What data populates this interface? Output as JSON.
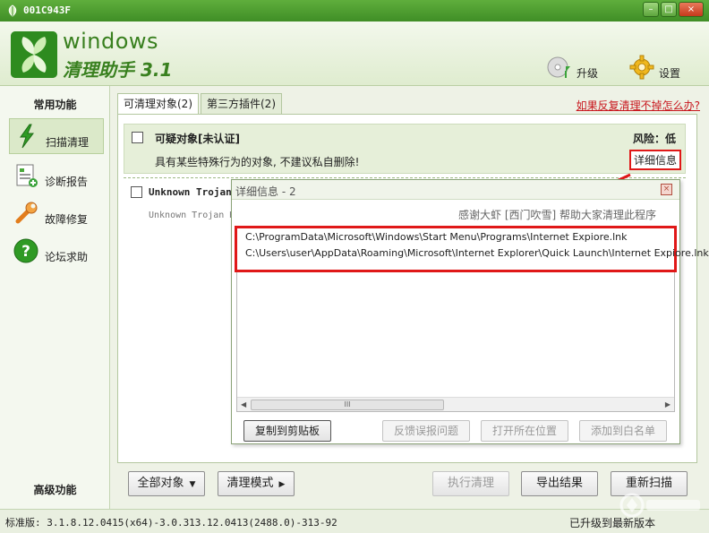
{
  "window": {
    "title": "001C943F",
    "min_glyph": "–",
    "max_glyph": "□",
    "close_glyph": "×"
  },
  "brand": {
    "line1": "windows",
    "line2": "清理助手 3.1"
  },
  "header": {
    "upgrade_label": "升级",
    "settings_label": "设置"
  },
  "sidebar": {
    "common_heading": "常用功能",
    "items": [
      {
        "label": "扫描清理",
        "icon": "lightning-icon",
        "active": true
      },
      {
        "label": "诊断报告",
        "icon": "report-icon"
      },
      {
        "label": "故障修复",
        "icon": "wrench-icon"
      },
      {
        "label": "论坛求助",
        "icon": "help-icon"
      }
    ],
    "advanced_heading": "高级功能"
  },
  "tabs": [
    {
      "label": "可清理对象(2)"
    },
    {
      "label": "第三方插件(2)"
    }
  ],
  "help_link": "如果反复清理不掉怎么办?",
  "items": [
    {
      "title": "可疑对象[未认证]",
      "risk": "风险：低",
      "desc": "具有某些特殊行为的对象, 不建议私自删除!",
      "detail": "详细信息"
    },
    {
      "title": "Unknown Trojan",
      "desc": "Unknown Trojan H"
    }
  ],
  "popup": {
    "title": "详细信息 - 2",
    "thanks": "感谢大虾 [西门吹雪] 帮助大家清理此程序",
    "paths": [
      "C:\\ProgramData\\Microsoft\\Windows\\Start Menu\\Programs\\Internet Expiore.lnk",
      "C:\\Users\\user\\AppData\\Roaming\\Microsoft\\Internet Explorer\\Quick Launch\\Internet Expiore.lnk"
    ],
    "buttons": {
      "copy": "复制到剪贴板",
      "report": "反馈误报问题",
      "open": "打开所在位置",
      "whitelist": "添加到白名单"
    },
    "scroll_left": "◀",
    "scroll_right": "▶",
    "scroll_grip": "III"
  },
  "bottom": {
    "all_objects": "全部对象",
    "clean_mode": "清理模式",
    "execute": "执行清理",
    "export": "导出结果",
    "rescan": "重新扫描",
    "dropdown_caret": "▼",
    "submenu_caret": "▶"
  },
  "status": {
    "version": "标准版: 3.1.8.12.0415(x64)-3.0.313.12.0413(2488.0)-313-92",
    "update": "已升级到最新版本"
  },
  "colors": {
    "brand_green": "#39801f",
    "highlight_red": "#e01818",
    "link_red": "#c8161d"
  }
}
